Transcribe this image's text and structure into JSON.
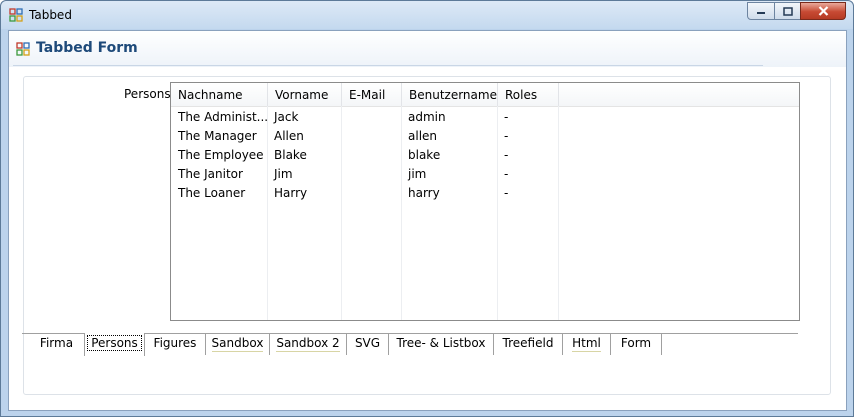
{
  "window": {
    "title": "Tabbed",
    "icon": "app-grid-icon",
    "controls": {
      "minimize": "minimize-icon",
      "maximize": "maximize-icon",
      "close": "close-icon"
    }
  },
  "form": {
    "title": "Tabbed Form",
    "icon": "form-grid-icon"
  },
  "persons": {
    "label": "Persons",
    "columns": [
      "Nachname",
      "Vorname",
      "E-Mail",
      "Benutzername",
      "Roles"
    ],
    "rows": [
      [
        "The Administ...",
        "Jack",
        "",
        "admin",
        "-"
      ],
      [
        "The Manager",
        "Allen",
        "",
        "allen",
        "-"
      ],
      [
        "The Employee",
        "Blake",
        "",
        "blake",
        "-"
      ],
      [
        "The Janitor",
        "Jim",
        "",
        "jim",
        "-"
      ],
      [
        "The Loaner",
        "Harry",
        "",
        "harry",
        "-"
      ]
    ]
  },
  "tabs": [
    {
      "label": "Firma"
    },
    {
      "label": "Persons",
      "selected": true
    },
    {
      "label": "Figures"
    },
    {
      "label": "Sandbox"
    },
    {
      "label": "Sandbox 2"
    },
    {
      "label": "SVG"
    },
    {
      "label": "Tree- & Listbox"
    },
    {
      "label": "Treefield"
    },
    {
      "label": "Html"
    },
    {
      "label": "Form"
    }
  ],
  "colors": {
    "titlebar": "#c4d9ef",
    "form_title": "#1e4a7a",
    "close_button": "#c74a33"
  }
}
